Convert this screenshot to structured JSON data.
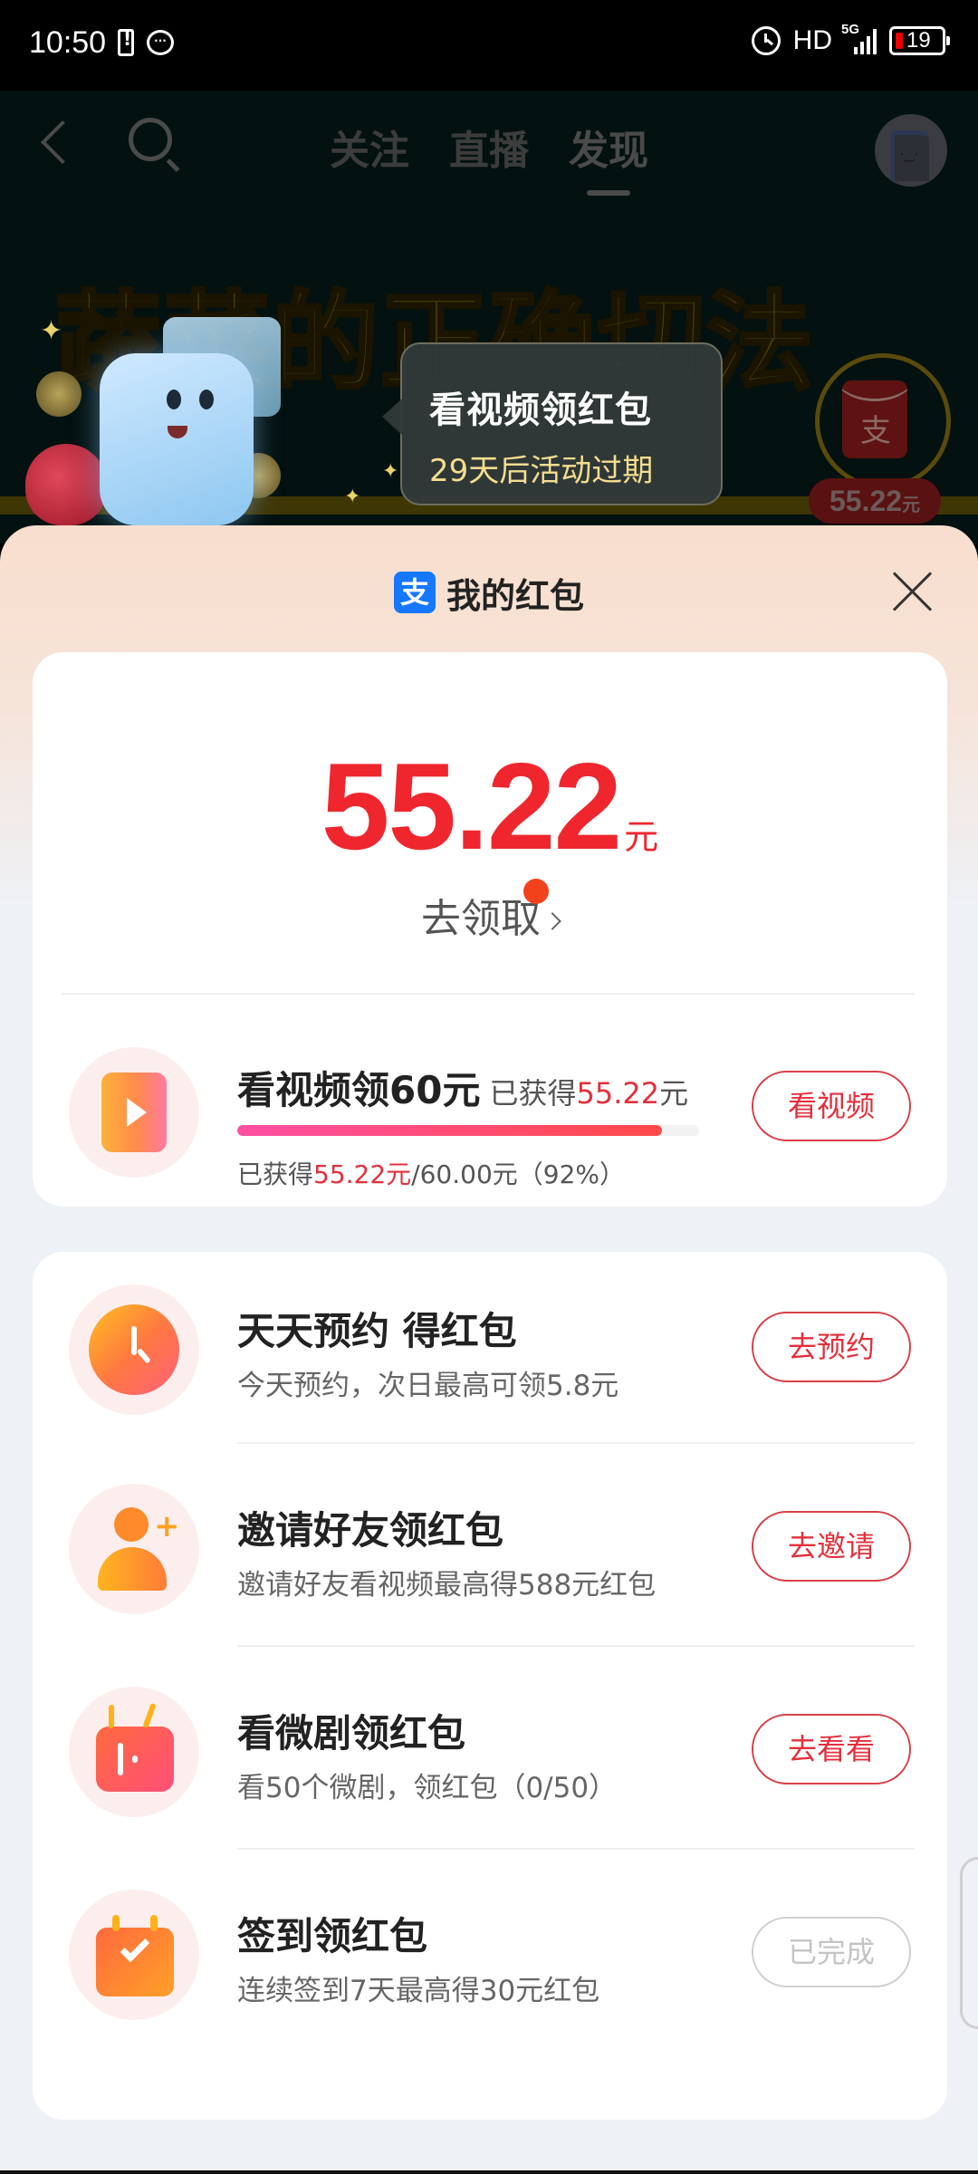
{
  "status_bar": {
    "time": "10:50",
    "network_label": "HD",
    "network_type": "5G",
    "battery_level": "19",
    "icons": [
      "battery-warning-icon",
      "message-icon",
      "alarm-icon",
      "signal-icon",
      "battery-icon"
    ]
  },
  "background_video": {
    "nav_tabs": [
      {
        "label": "关注",
        "active": false
      },
      {
        "label": "直播",
        "active": false
      },
      {
        "label": "发现",
        "active": true
      }
    ],
    "banner_text": "蔬菜的正确切法",
    "tooltip": {
      "title": "看视频领红包",
      "subtitle": "29天后活动过期"
    },
    "red_packet_badge": {
      "logo": "支",
      "amount": "55.22",
      "unit": "元"
    }
  },
  "sheet": {
    "logo": "支",
    "title": "我的红包",
    "balance": {
      "amount": "55.22",
      "unit": "元",
      "claim_label": "去领取"
    },
    "video_task": {
      "title": "看视频领60元",
      "earned_prefix": "已获得",
      "earned_amount": "55.22",
      "earned_unit": "元",
      "progress_percent": 92,
      "progress_prefix": "已获得",
      "progress_earned": "55.22元",
      "progress_rest": "/60.00元（92%）",
      "button": "看视频"
    },
    "tasks": [
      {
        "title": "天天预约 得红包",
        "desc": "今天预约，次日最高可领5.8元",
        "button": "去预约",
        "done": false
      },
      {
        "title": "邀请好友领红包",
        "desc": "邀请好友看视频最高得588元红包",
        "button": "去邀请",
        "done": false
      },
      {
        "title": "看微剧领红包",
        "desc": "看50个微剧，领红包（0/50）",
        "button": "去看看",
        "done": false
      },
      {
        "title": "签到领红包",
        "desc": "连续签到7天最高得30元红包",
        "button": "已完成",
        "done": true
      }
    ]
  },
  "colors": {
    "accent_red": "#e3303c",
    "balance_red": "#f0262e",
    "alipay_blue": "#1677ff"
  }
}
